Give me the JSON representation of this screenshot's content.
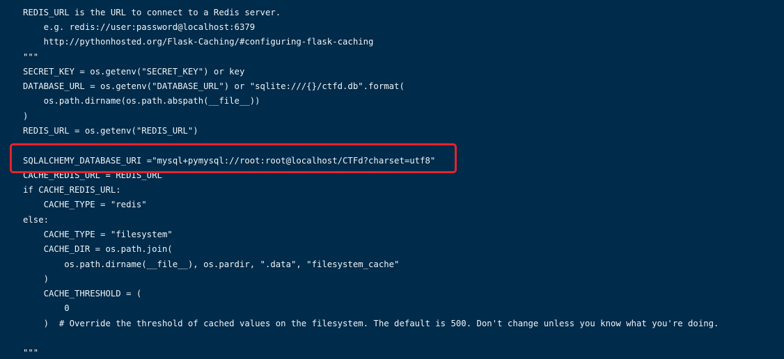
{
  "editor": {
    "lines": [
      "REDIS_URL is the URL to connect to a Redis server.",
      "    e.g. redis://user:password@localhost:6379",
      "    http://pythonhosted.org/Flask-Caching/#configuring-flask-caching",
      "\"\"\"",
      "SECRET_KEY = os.getenv(\"SECRET_KEY\") or key",
      "DATABASE_URL = os.getenv(\"DATABASE_URL\") or \"sqlite:///{}/ctfd.db\".format(",
      "    os.path.dirname(os.path.abspath(__file__))",
      ")",
      "REDIS_URL = os.getenv(\"REDIS_URL\")",
      "",
      "SQLALCHEMY_DATABASE_URI =\"mysql+pymysql://root:root@localhost/CTFd?charset=utf8\"",
      "CACHE_REDIS_URL = REDIS_URL",
      "if CACHE_REDIS_URL:",
      "    CACHE_TYPE = \"redis\"",
      "else:",
      "    CACHE_TYPE = \"filesystem\"",
      "    CACHE_DIR = os.path.join(",
      "        os.path.dirname(__file__), os.pardir, \".data\", \"filesystem_cache\"",
      "    )",
      "    CACHE_THRESHOLD = (",
      "        0",
      "    )  # Override the threshold of cached values on the filesystem. The default is 500. Don't change unless you know what you're doing.",
      "",
      "\"\"\""
    ]
  },
  "colors": {
    "background": "#012b4a",
    "text": "#eef3f7",
    "highlight_border": "#e8232a"
  }
}
